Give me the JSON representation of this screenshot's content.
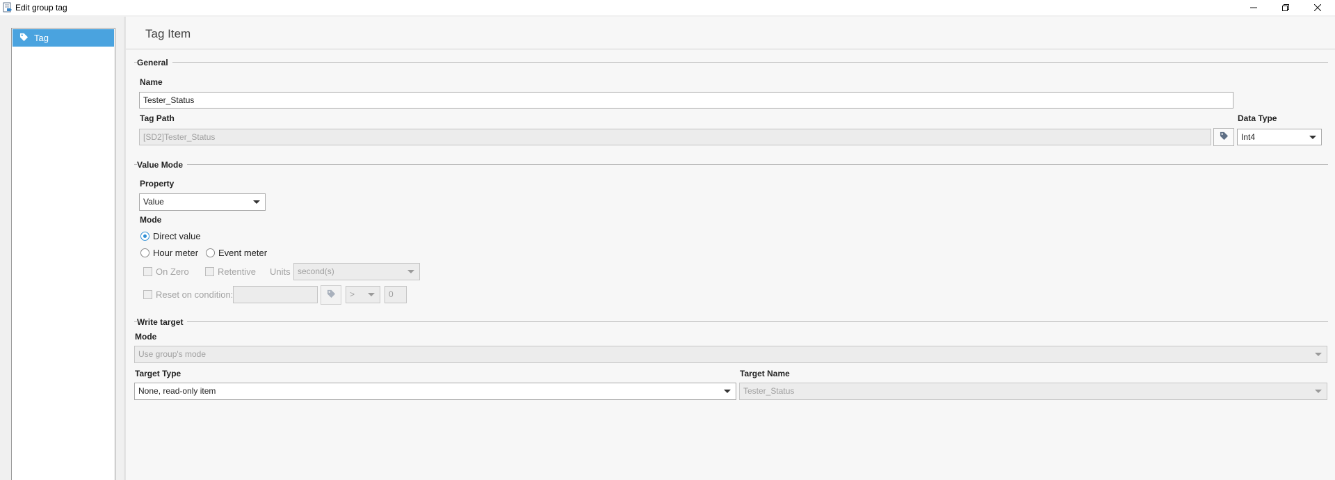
{
  "window": {
    "title": "Edit group tag",
    "icons": {
      "app": "tag-document-icon",
      "minimize": "minimize-icon",
      "maximize": "restore-icon",
      "close": "close-icon"
    }
  },
  "sidebar": {
    "items": [
      {
        "label": "Tag",
        "icon": "tag-icon",
        "selected": true
      }
    ]
  },
  "page": {
    "title": "Tag Item"
  },
  "general": {
    "header": "General",
    "name_label": "Name",
    "name_value": "Tester_Status",
    "tag_path_label": "Tag Path",
    "tag_path_value": "[SD2]Tester_Status",
    "data_type_label": "Data Type",
    "data_type_value": "Int4"
  },
  "value_mode": {
    "header": "Value Mode",
    "property_label": "Property",
    "property_value": "Value",
    "mode_label": "Mode",
    "modes": [
      {
        "label": "Direct value",
        "selected": true
      },
      {
        "label": "Hour meter",
        "selected": false
      },
      {
        "label": "Event meter",
        "selected": false
      }
    ],
    "on_zero_label": "On Zero",
    "retentive_label": "Retentive",
    "units_label": "Units",
    "units_value": "second(s)",
    "reset_label": "Reset on condition:",
    "reset_value": "",
    "operator_value": ">",
    "threshold_value": "0"
  },
  "write_target": {
    "header": "Write target",
    "mode_label": "Mode",
    "mode_value": "Use group's mode",
    "target_type_label": "Target Type",
    "target_type_value": "None, read-only item",
    "target_name_label": "Target Name",
    "target_name_value": "Tester_Status"
  },
  "colors": {
    "accent": "#4aa3df",
    "radio_selected": "#2f8fd5",
    "background": "#f7f7f7"
  }
}
